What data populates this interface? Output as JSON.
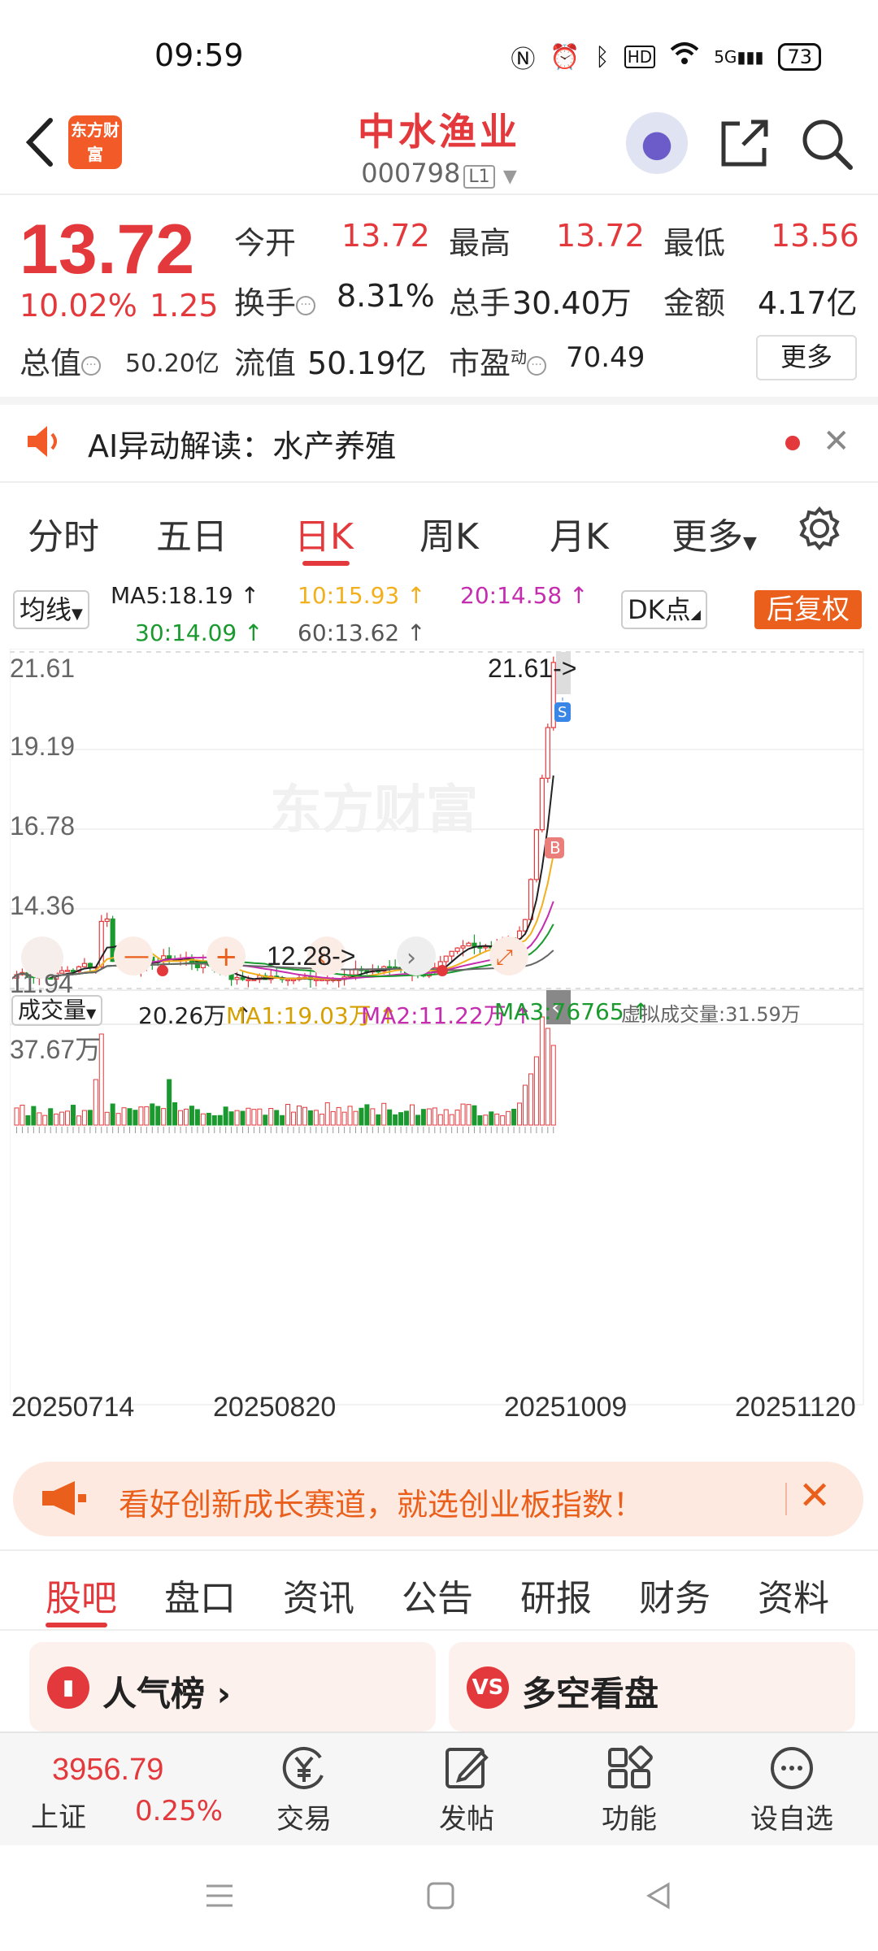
{
  "status_bar": {
    "time": "09:59",
    "network": "5G",
    "battery": "73"
  },
  "header": {
    "logo_text": "东方财富",
    "title": "中水渔业",
    "code": "000798",
    "code_tag": "L1"
  },
  "quote": {
    "price": "13.72",
    "change_pct": "10.02%",
    "change": "1.25",
    "market_cap_label": "总值",
    "market_cap": "50.20亿",
    "open_label": "今开",
    "open": "13.72",
    "high_label": "最高",
    "high": "13.72",
    "low_label": "最低",
    "low": "13.56",
    "turnover_label": "换手",
    "turnover": "8.31%",
    "volume_label": "总手",
    "volume": "30.40万",
    "amount_label": "金额",
    "amount": "4.17亿",
    "float_label": "流值",
    "float_cap": "50.19亿",
    "pe_label": "市盈",
    "pe_super": "动",
    "pe": "70.49",
    "more_label": "更多"
  },
  "ai_bar": {
    "text": "AI异动解读：水产养殖"
  },
  "chart_tabs": [
    "分时",
    "五日",
    "日K",
    "周K",
    "月K",
    "更多"
  ],
  "ma_legend": {
    "selector": "均线",
    "ma5": "MA5:18.19 ↑",
    "ma10": "10:15.93 ↑",
    "ma20": "20:14.58 ↑",
    "ma30": "30:14.09 ↑",
    "ma60": "60:13.62 ↑",
    "dk_label": "DK点",
    "fq_label": "后复权"
  },
  "colors": {
    "ma5": "#222222",
    "ma10": "#f2b01e",
    "ma20": "#c62dae",
    "ma30": "#1a9a2e",
    "ma60": "#666666",
    "up": "#e4393c",
    "down": "#1a9a2e",
    "accent": "#e95f1b"
  },
  "chart_data": {
    "type": "candlestick",
    "price_axis": {
      "labels": [
        "21.61",
        "19.19",
        "16.78",
        "14.36",
        "11.94"
      ],
      "max_marker": "21.61->",
      "min_marker": "12.28->"
    },
    "volume_legend": {
      "selector": "成交量",
      "vol": "20.26万 ↑",
      "ma1": "MA1:19.03万 ↑",
      "ma2": "MA2:11.22万 ↑",
      "ma3": "MA3:76765 ↑",
      "virtual": "虚拟成交量:31.59万"
    },
    "volume_axis_max": "37.67万",
    "dates": [
      "20250714",
      "20250820",
      "20251009",
      "20251120"
    ],
    "markers": {
      "buy": "B",
      "sell": "S"
    }
  },
  "promo": {
    "text": "看好创新成长赛道，就选创业板指数！"
  },
  "bottom_tabs": [
    "股吧",
    "盘口",
    "资讯",
    "公告",
    "研报",
    "财务",
    "资料"
  ],
  "cards": [
    {
      "icon": "▮",
      "label": "人气榜 ›"
    },
    {
      "icon": "VS",
      "label": "多空看盘"
    }
  ],
  "bottom_bar": {
    "index_value": "3956.79",
    "index_name": "上证",
    "index_pct": "0.25%",
    "items": [
      "交易",
      "发帖",
      "功能",
      "设自选"
    ]
  }
}
